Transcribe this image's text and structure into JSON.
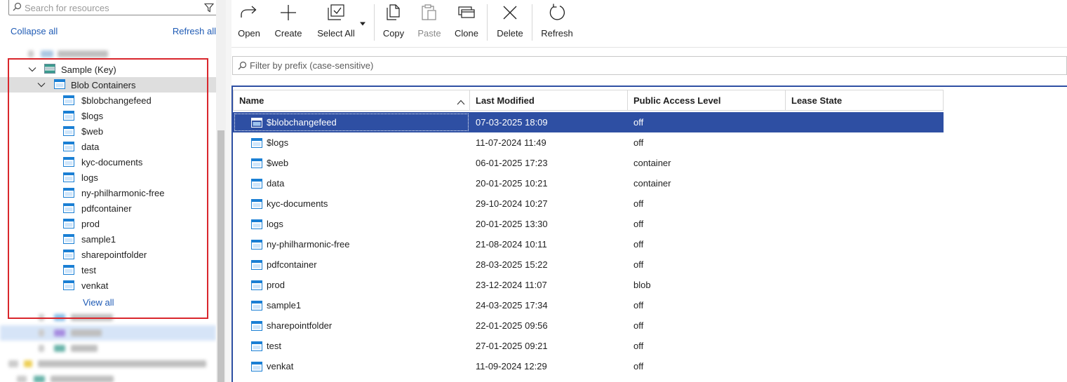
{
  "sidebar": {
    "search_placeholder": "Search for resources",
    "collapse_all": "Collapse all",
    "refresh_all": "Refresh all",
    "account": "Sample (Key)",
    "blob_group": "Blob Containers",
    "containers": [
      "$blobchangefeed",
      "$logs",
      "$web",
      "data",
      "kyc-documents",
      "logs",
      "ny-philharmonic-free",
      "pdfcontainer",
      "prod",
      "sample1",
      "sharepointfolder",
      "test",
      "venkat"
    ],
    "view_all": "View all"
  },
  "toolbar": {
    "open": "Open",
    "create": "Create",
    "select_all": "Select All",
    "copy": "Copy",
    "paste": "Paste",
    "clone": "Clone",
    "delete": "Delete",
    "refresh": "Refresh"
  },
  "filter": {
    "placeholder": "Filter by prefix (case-sensitive)"
  },
  "grid": {
    "columns": [
      "Name",
      "Last Modified",
      "Public Access Level",
      "Lease State"
    ],
    "rows": [
      {
        "name": "$blobchangefeed",
        "modified": "07-03-2025 18:09",
        "access": "off",
        "lease": ""
      },
      {
        "name": "$logs",
        "modified": "11-07-2024 11:49",
        "access": "off",
        "lease": ""
      },
      {
        "name": "$web",
        "modified": "06-01-2025 17:23",
        "access": "container",
        "lease": ""
      },
      {
        "name": "data",
        "modified": "20-01-2025 10:21",
        "access": "container",
        "lease": ""
      },
      {
        "name": "kyc-documents",
        "modified": "29-10-2024 10:27",
        "access": "off",
        "lease": ""
      },
      {
        "name": "logs",
        "modified": "20-01-2025 13:30",
        "access": "off",
        "lease": ""
      },
      {
        "name": "ny-philharmonic-free",
        "modified": "21-08-2024 10:11",
        "access": "off",
        "lease": ""
      },
      {
        "name": "pdfcontainer",
        "modified": "28-03-2025 15:22",
        "access": "off",
        "lease": ""
      },
      {
        "name": "prod",
        "modified": "23-12-2024 11:07",
        "access": "blob",
        "lease": ""
      },
      {
        "name": "sample1",
        "modified": "24-03-2025 17:34",
        "access": "off",
        "lease": ""
      },
      {
        "name": "sharepointfolder",
        "modified": "22-01-2025 09:56",
        "access": "off",
        "lease": ""
      },
      {
        "name": "test",
        "modified": "27-01-2025 09:21",
        "access": "off",
        "lease": ""
      },
      {
        "name": "venkat",
        "modified": "11-09-2024 12:29",
        "access": "off",
        "lease": ""
      }
    ],
    "selected_index": 0
  },
  "colors": {
    "accent": "#2e4fa3",
    "link": "#1f5bb5",
    "highlight": "#d9262c",
    "container_icon": "#1a7fd4"
  }
}
